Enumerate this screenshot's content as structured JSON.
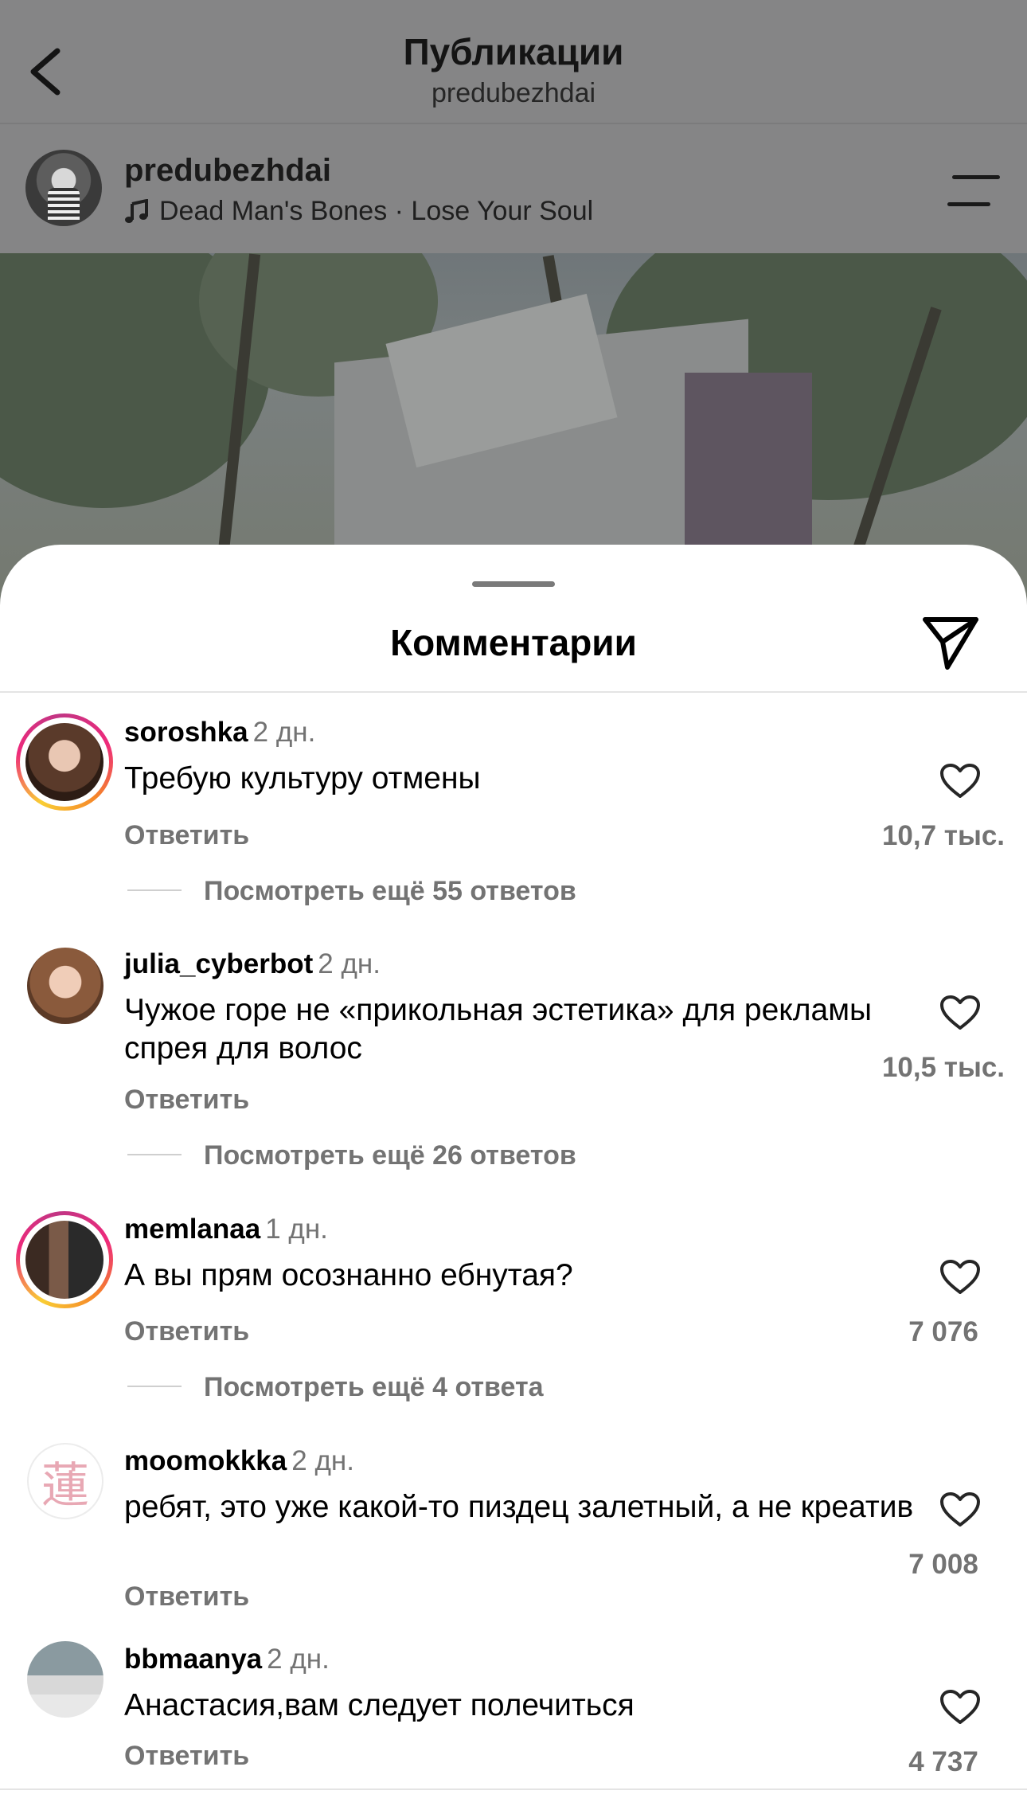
{
  "header": {
    "title": "Публикации",
    "subtitle": "predubezhdai"
  },
  "post": {
    "username": "predubezhdai",
    "music": "Dead Man's Bones · Lose Your Soul"
  },
  "comments_sheet": {
    "title": "Комментарии"
  },
  "comments": [
    {
      "username": "soroshka",
      "time": "2 дн.",
      "text": "Требую культуру отмены",
      "reply_label": "Ответить",
      "likes": "10,7 тыс.",
      "view_more": "Посмотреть ещё 55 ответов",
      "story_ring": true
    },
    {
      "username": "julia_cyberbot",
      "time": "2 дн.",
      "text": "Чужое горе не «прикольная эстетика» для рекламы спрея для волос",
      "reply_label": "Ответить",
      "likes": "10,5 тыс.",
      "view_more": "Посмотреть ещё 26 ответов",
      "story_ring": false
    },
    {
      "username": "memlanaa",
      "time": "1 дн.",
      "text": "А вы прям осознанно ебнутая?",
      "reply_label": "Ответить",
      "likes": "7 076",
      "view_more": "Посмотреть ещё 4 ответа",
      "story_ring": true
    },
    {
      "username": "moomokkka",
      "time": "2 дн.",
      "text": "ребят, это уже какой-то пиздец залетный, а не креатив",
      "reply_label": "Ответить",
      "likes": "7 008",
      "avatar_glyph": "蓮",
      "story_ring": false
    },
    {
      "username": "bbmaanya",
      "time": "2 дн.",
      "text": "Анастасия,вам следует полечиться",
      "reply_label": "Ответить",
      "likes": "4 737",
      "story_ring": false
    }
  ],
  "icons": {
    "back": "chevron-left-icon",
    "music": "music-note-icon",
    "menu": "filter-menu-icon",
    "send": "send-icon",
    "like": "heart-outline-icon"
  },
  "colors": {
    "overlay_gray": "#858586",
    "secondary_text": "#737373",
    "story_ring_start": "#f9ce34",
    "story_ring_end": "#ee2a7b"
  }
}
